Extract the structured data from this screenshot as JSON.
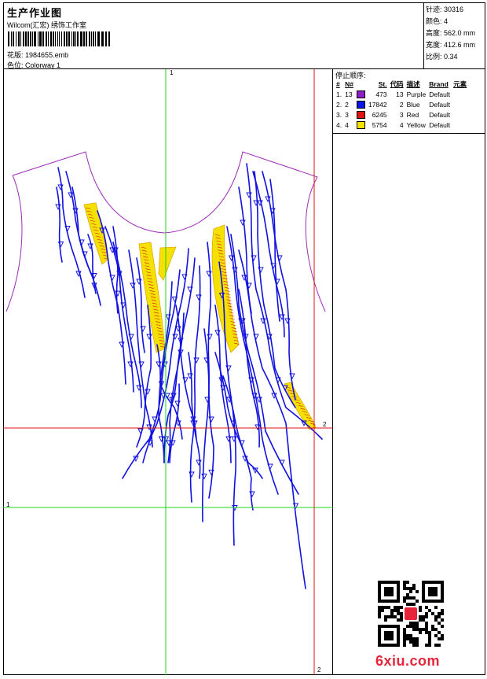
{
  "header": {
    "title": "生产作业图",
    "company": "Wilcom(汇宏) 绣饰工作室",
    "design_label": "花版:",
    "design_file": "1984655.emb",
    "colorway_label": "色位:",
    "colorway": "Colorway 1"
  },
  "props": [
    {
      "label": "针迹:",
      "value": "30316"
    },
    {
      "label": "颜色:",
      "value": "4"
    },
    {
      "label": "高度:",
      "value": "562.0 mm"
    },
    {
      "label": "宽度:",
      "value": "412.6 mm"
    },
    {
      "label": "比例:",
      "value": "0.34"
    }
  ],
  "stop_sequence": {
    "label": "停止顺序:",
    "columns": [
      "#",
      "N#",
      "St.",
      "代码",
      "描述",
      "Brand",
      "元素"
    ],
    "rows": [
      {
        "idx": "1.",
        "n": "13",
        "color": "#8a1ec8",
        "st": "473",
        "code": "13",
        "desc": "Purple",
        "brand": "Default"
      },
      {
        "idx": "2.",
        "n": "2",
        "color": "#0b16e6",
        "st": "17842",
        "code": "2",
        "desc": "Blue",
        "brand": "Default"
      },
      {
        "idx": "3.",
        "n": "3",
        "color": "#e21212",
        "st": "6245",
        "code": "3",
        "desc": "Red",
        "brand": "Default"
      },
      {
        "idx": "4.",
        "n": "4",
        "color": "#f5e100",
        "st": "5754",
        "code": "4",
        "desc": "Yellow",
        "brand": "Default"
      }
    ]
  },
  "guides": {
    "green_1_top": "1",
    "green_1_left": "1",
    "red_2_right": "2",
    "red_2_bottom": "2"
  },
  "watermark": "6xiu.com"
}
